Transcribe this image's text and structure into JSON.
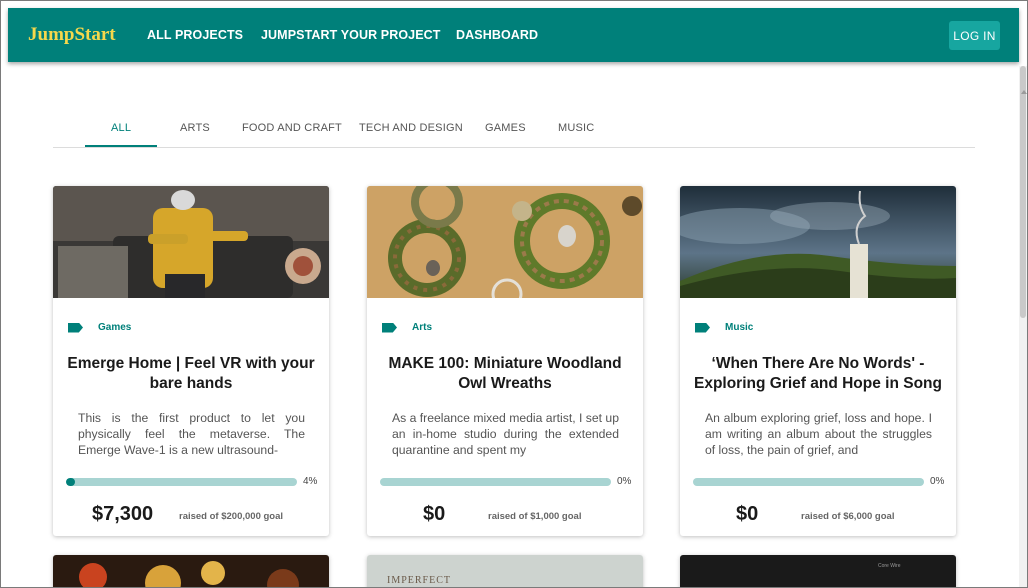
{
  "navbar": {
    "brand": "JumpStart",
    "links": [
      "ALL PROJECTS",
      "JUMPSTART YOUR PROJECT",
      "DASHBOARD"
    ],
    "login": "LOG IN"
  },
  "tabs": [
    "ALL",
    "ARTS",
    "FOOD AND CRAFT",
    "TECH AND DESIGN",
    "GAMES",
    "MUSIC"
  ],
  "active_tab": "ALL",
  "colors": {
    "primary": "#00807a",
    "brand_text": "#f5d84c",
    "progress_track": "#a8d4d2"
  },
  "projects": [
    {
      "category": "Games",
      "title": "Emerge Home | Feel VR with your bare hands",
      "description": "This is the first product to let you physically feel the metaverse. The Emerge Wave-1 is a new ultrasound-",
      "percent_label": "4%",
      "progress": 0.04,
      "raised": "$7,300",
      "goal": "raised of $200,000 goal",
      "image": "person-vr-headset-photo"
    },
    {
      "category": "Arts",
      "title": "MAKE 100: Miniature Woodland Owl Wreaths",
      "description": "As a freelance mixed media artist, I set up an in-home studio during the extended quarantine and spent my",
      "percent_label": "0%",
      "progress": 0,
      "raised": "$0",
      "goal": "raised of $1,000 goal",
      "image": "owl-wreaths-photo"
    },
    {
      "category": "Music",
      "title": "‘When There Are No Words' - Exploring Grief and Hope in Song",
      "description": "An album exploring grief, loss and hope. I am writing an album about the struggles of loss, the pain of grief, and",
      "percent_label": "0%",
      "progress": 0,
      "raised": "$0",
      "goal": "raised of $6,000 goal",
      "image": "candle-landscape-painting"
    }
  ],
  "next_row_images": [
    "food-photo",
    "map-photo",
    "dark-device-photo"
  ],
  "next_row_text": [
    "IMPERFECT",
    "Core Wire"
  ]
}
